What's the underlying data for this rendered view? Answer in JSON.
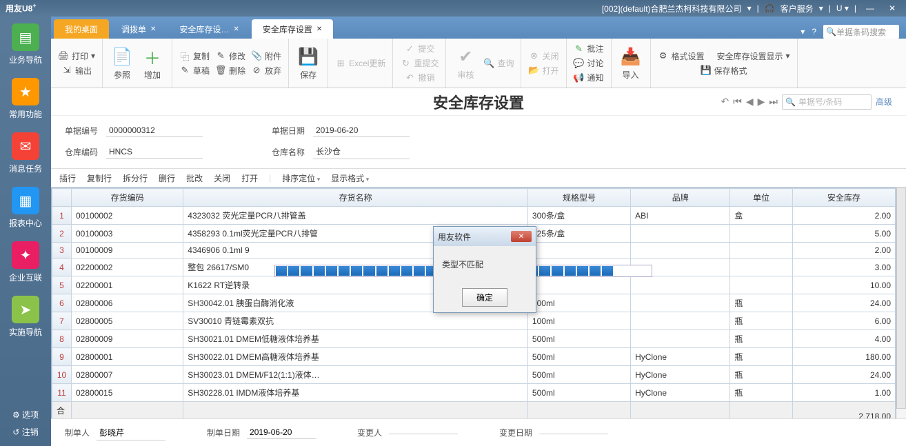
{
  "titlebar": {
    "app_name": "用友U8",
    "company": "[002](default)合肥兰杰柯科技有限公司",
    "service": "客户服务"
  },
  "sidebar": {
    "items": [
      {
        "label": "业务导航",
        "color": "#4caf50"
      },
      {
        "label": "常用功能",
        "color": "#ff9800"
      },
      {
        "label": "消息任务",
        "color": "#f44336"
      },
      {
        "label": "报表中心",
        "color": "#2196f3"
      },
      {
        "label": "企业互联",
        "color": "#e91e63"
      },
      {
        "label": "实施导航",
        "color": "#8bc34a"
      }
    ],
    "options": "选项",
    "logout": "注销"
  },
  "tabs": {
    "items": [
      {
        "label": "我的桌面",
        "active_sub": true
      },
      {
        "label": "调拨单"
      },
      {
        "label": "安全库存设…"
      },
      {
        "label": "安全库存设置",
        "active": true
      }
    ],
    "search_placeholder": "单据条码搜索"
  },
  "ribbon": {
    "print": "打印",
    "output": "输出",
    "ref": "参照",
    "add": "增加",
    "copy": "复制",
    "draft": "草稿",
    "modify": "修改",
    "delete": "删除",
    "attach": "附件",
    "abandon": "放弃",
    "save": "保存",
    "excel": "Excel更新",
    "submit": "提交",
    "resubmit": "重提交",
    "revoke": "撤销",
    "verify": "审核",
    "query": "查询",
    "close_doc": "关闭",
    "open_doc": "打开",
    "approve": "批注",
    "discuss": "讨论",
    "notify": "通知",
    "import": "导入",
    "fmt": "格式设置",
    "disp": "安全库存设置显示",
    "savefmt": "保存格式"
  },
  "doc": {
    "title": "安全库存设置",
    "search_placeholder": "单据号/条码",
    "advanced": "高级",
    "fields": {
      "code_label": "单据编号",
      "code": "0000000312",
      "date_label": "单据日期",
      "date": "2019-06-20",
      "wh_code_label": "仓库编码",
      "wh_code": "HNCS",
      "wh_name_label": "仓库名称",
      "wh_name": "长沙仓"
    }
  },
  "inner_toolbar": {
    "insert_row": "插行",
    "copy_row": "复制行",
    "split_row": "拆分行",
    "del_row": "删行",
    "batch": "批改",
    "close": "关闭",
    "open": "打开",
    "sort": "排序定位",
    "display": "显示格式"
  },
  "table": {
    "headers": [
      "存货编码",
      "存货名称",
      "规格型号",
      "品牌",
      "单位",
      "安全库存"
    ],
    "rows": [
      {
        "n": "1",
        "code": "00100002",
        "name": "4323032 荧光定量PCR八排管盖",
        "spec": "300条/盒",
        "brand": "ABI",
        "unit": "盒",
        "qty": "2.00"
      },
      {
        "n": "2",
        "code": "00100003",
        "name": "4358293 0.1ml荧光定量PCR八排管",
        "spec": "125条/盒",
        "brand": "",
        "unit": "",
        "qty": "5.00"
      },
      {
        "n": "3",
        "code": "00100009",
        "name": "4346906 0.1ml 9",
        "spec": "",
        "brand": "",
        "unit": "",
        "qty": "2.00"
      },
      {
        "n": "4",
        "code": "02200002",
        "name": "整包 26617/SM0",
        "spec": "",
        "brand": "",
        "unit": "",
        "qty": "3.00"
      },
      {
        "n": "5",
        "code": "02200001",
        "name": "K1622 RT逆转录",
        "spec": "",
        "brand": "",
        "unit": "",
        "qty": "10.00"
      },
      {
        "n": "6",
        "code": "02800006",
        "name": "SH30042.01 胰蛋白酶消化液",
        "spec": "100ml",
        "brand": "",
        "unit": "瓶",
        "qty": "24.00"
      },
      {
        "n": "7",
        "code": "02800005",
        "name": "SV30010 青链霉素双抗",
        "spec": "100ml",
        "brand": "",
        "unit": "瓶",
        "qty": "6.00"
      },
      {
        "n": "8",
        "code": "02800009",
        "name": "SH30021.01 DMEM低糖液体培养基",
        "spec": "500ml",
        "brand": "",
        "unit": "瓶",
        "qty": "4.00"
      },
      {
        "n": "9",
        "code": "02800001",
        "name": "SH30022.01 DMEM高糖液体培养基",
        "spec": "500ml",
        "brand": "HyClone",
        "unit": "瓶",
        "qty": "180.00"
      },
      {
        "n": "10",
        "code": "02800007",
        "name": "SH30023.01 DMEM/F12(1:1)液体…",
        "spec": "500ml",
        "brand": "HyClone",
        "unit": "瓶",
        "qty": "24.00"
      },
      {
        "n": "11",
        "code": "02800015",
        "name": "SH30228.01 IMDM液体培养基",
        "spec": "500ml",
        "brand": "HyClone",
        "unit": "瓶",
        "qty": "1.00"
      }
    ],
    "total_label": "合计",
    "total": "2,718.00"
  },
  "footer": {
    "maker_label": "制单人",
    "maker": "彭晓芹",
    "mdate_label": "制单日期",
    "mdate": "2019-06-20",
    "changer_label": "变更人",
    "changer": "",
    "cdate_label": "变更日期",
    "cdate": ""
  },
  "dialog": {
    "title": "用友软件",
    "message": "类型不匹配",
    "ok": "确定"
  }
}
